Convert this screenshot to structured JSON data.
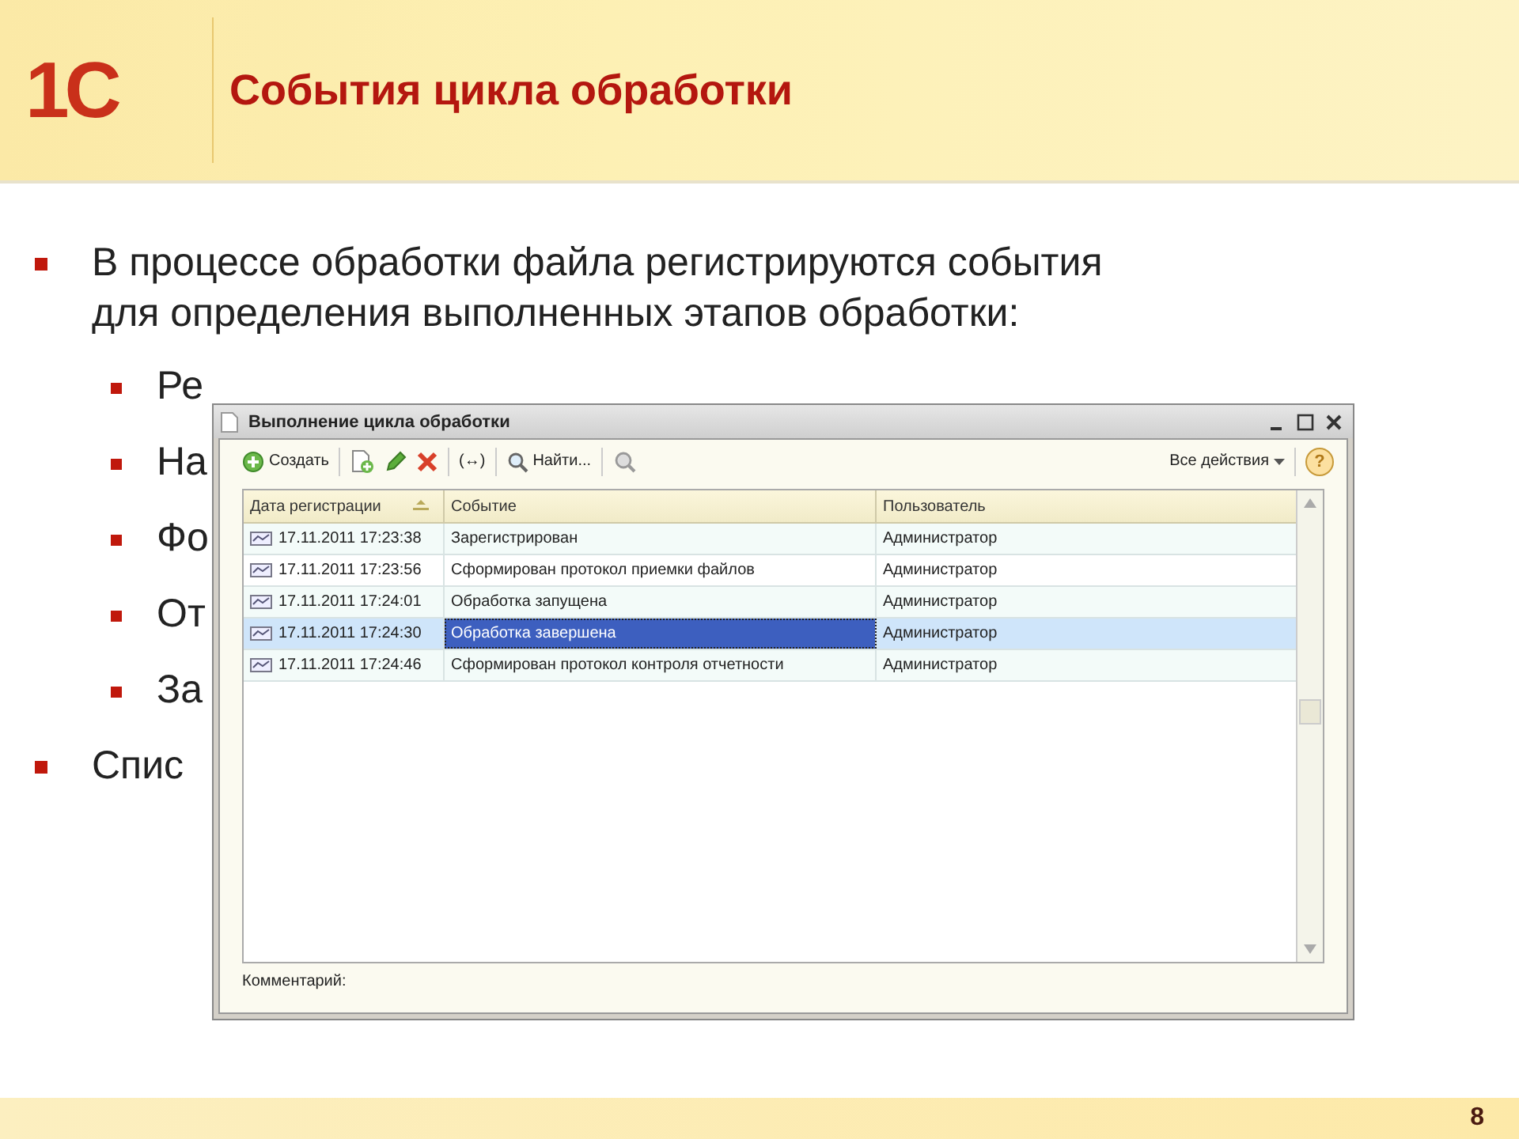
{
  "slide": {
    "logo": "1С",
    "title": "События цикла обработки",
    "page_number": "8"
  },
  "bullets": [
    {
      "text": "В процессе обработки файла регистрируются события для определения выполненных этапов обработки:",
      "children": [
        {
          "text": "Ре"
        },
        {
          "text": "На"
        },
        {
          "text": "Фо"
        },
        {
          "text": "От"
        },
        {
          "text": "За"
        }
      ]
    },
    {
      "text": "Спис"
    }
  ],
  "window": {
    "title": "Выполнение цикла обработки",
    "toolbar": [
      {
        "kind": "create",
        "label": "Создать"
      },
      {
        "kind": "separator"
      },
      {
        "kind": "copy"
      },
      {
        "kind": "edit"
      },
      {
        "kind": "delete"
      },
      {
        "kind": "separator"
      },
      {
        "kind": "plain",
        "label": "(↔)"
      },
      {
        "kind": "separator"
      },
      {
        "kind": "find",
        "label": "Найти..."
      },
      {
        "kind": "separator"
      },
      {
        "kind": "findclear"
      }
    ],
    "all_actions": "Все действия",
    "help": "?",
    "table": {
      "columns": [
        "Дата регистрации",
        "Событие",
        "Пользователь"
      ],
      "rows": [
        {
          "date": "17.11.2011 17:23:38",
          "event": "Зарегистрирован",
          "user": "Администратор",
          "selected": false
        },
        {
          "date": "17.11.2011 17:23:56",
          "event": "Сформирован протокол приемки файлов",
          "user": "Администратор",
          "selected": false
        },
        {
          "date": "17.11.2011 17:24:01",
          "event": "Обработка запущена",
          "user": "Администратор",
          "selected": false
        },
        {
          "date": "17.11.2011 17:24:30",
          "event": "Обработка завершена",
          "user": "Администратор",
          "selected": true
        },
        {
          "date": "17.11.2011 17:24:46",
          "event": "Сформирован протокол контроля отчетности",
          "user": "Администратор",
          "selected": false
        }
      ]
    },
    "comment_label": "Комментарий:"
  }
}
